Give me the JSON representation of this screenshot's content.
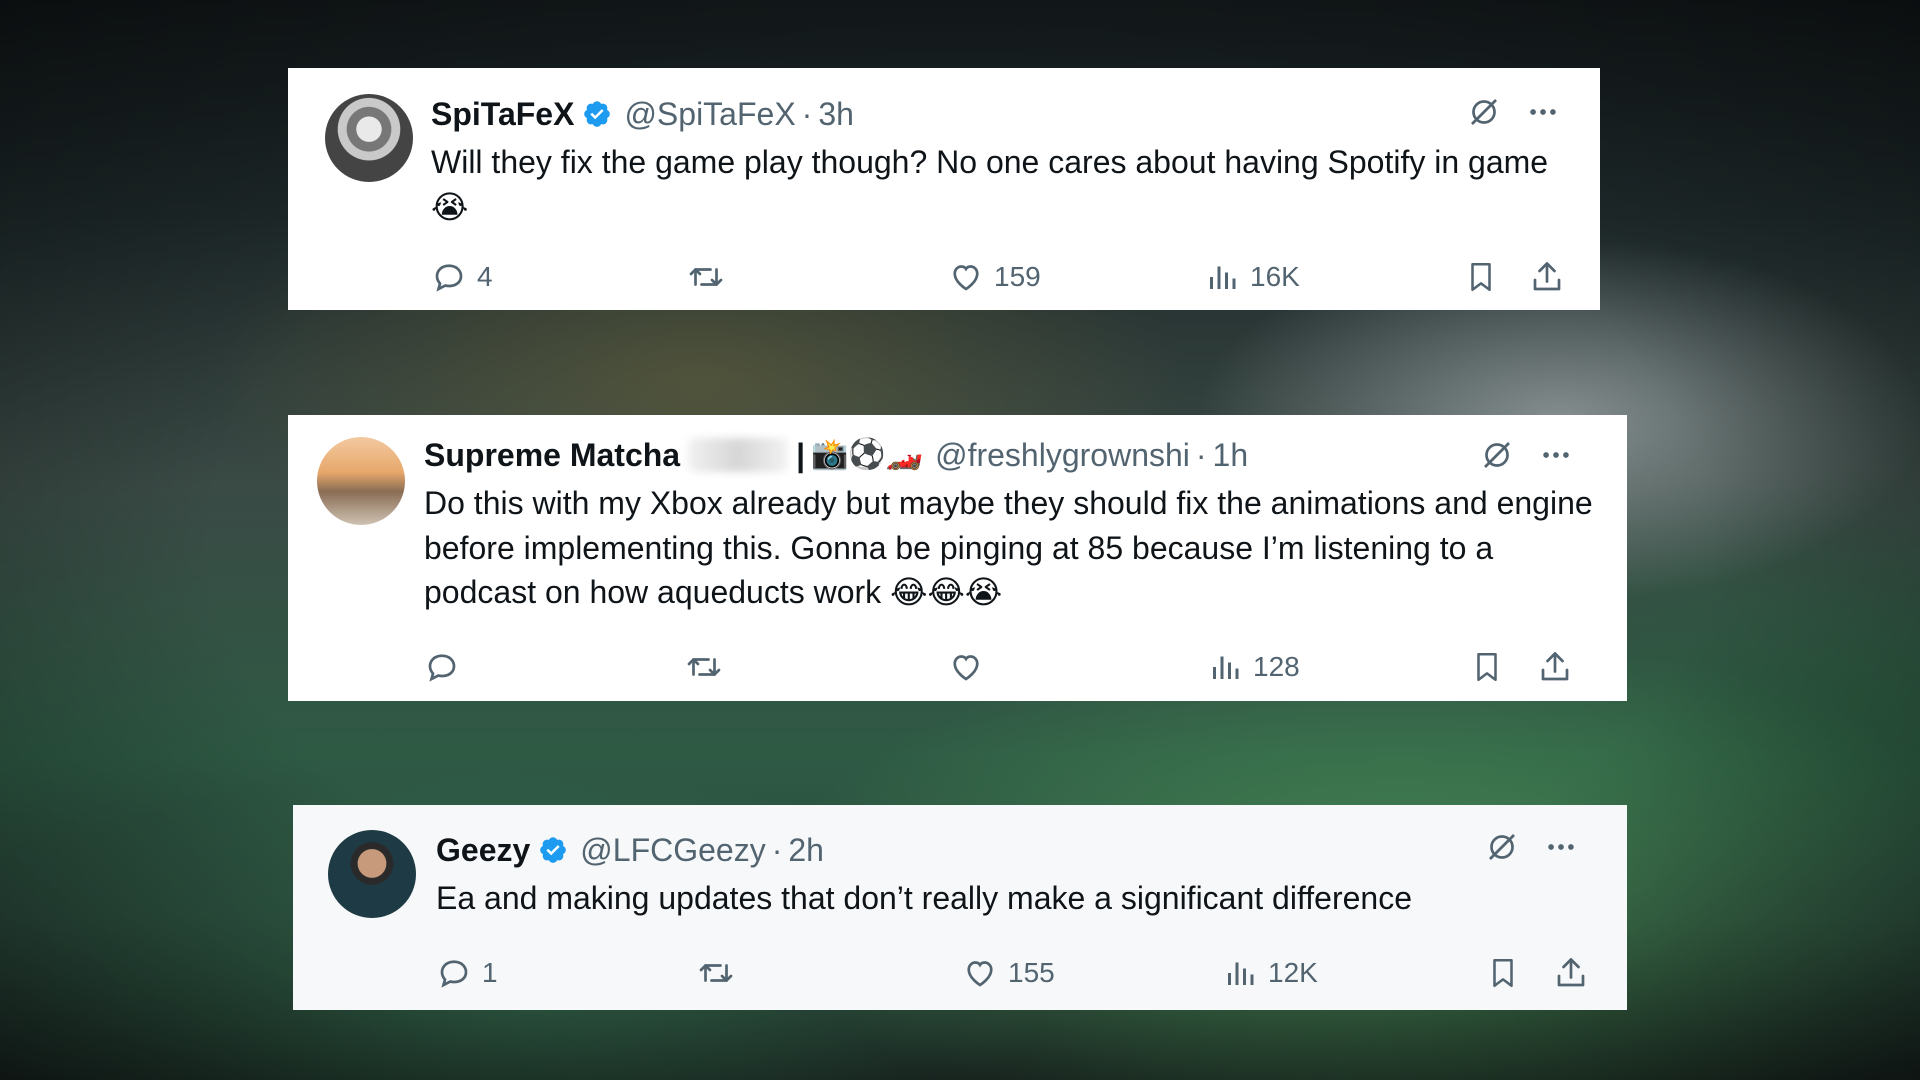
{
  "tweets": [
    {
      "display_name": "SpiTaFeX",
      "verified": true,
      "handle": "@SpiTaFeX",
      "separator": "·",
      "time": "3h",
      "text": "Will they fix the game play though? No one cares about having Spotify in game 😭",
      "replies": "4",
      "retweets": "",
      "likes": "159",
      "views": "16K"
    },
    {
      "display_name": "Supreme Matcha",
      "verified": false,
      "name_separator": "|",
      "name_emojis": "📸⚽🏎️",
      "handle": "@freshlygrownshi",
      "separator": "·",
      "time": "1h",
      "text": "Do this with my Xbox already but maybe they should fix the animations and engine before implementing this. Gonna be pinging at 85 because I’m listening to a podcast on how aqueducts work 😂😂😭",
      "replies": "",
      "retweets": "",
      "likes": "",
      "views": "128"
    },
    {
      "display_name": "Geezy",
      "verified": true,
      "handle": "@LFCGeezy",
      "separator": "·",
      "time": "2h",
      "text": "Ea and making updates that don’t really make a significant difference",
      "replies": "1",
      "retweets": "",
      "likes": "155",
      "views": "12K"
    }
  ],
  "icons": {
    "verified": "verified-badge-icon",
    "grok": "grok-icon",
    "more": "more-icon",
    "reply": "reply-icon",
    "retweet": "retweet-icon",
    "like": "heart-icon",
    "views": "views-icon",
    "bookmark": "bookmark-icon",
    "share": "share-icon"
  },
  "colors": {
    "verified": "#1d9bf0",
    "text": "#0f1419",
    "secondary": "#536471"
  }
}
